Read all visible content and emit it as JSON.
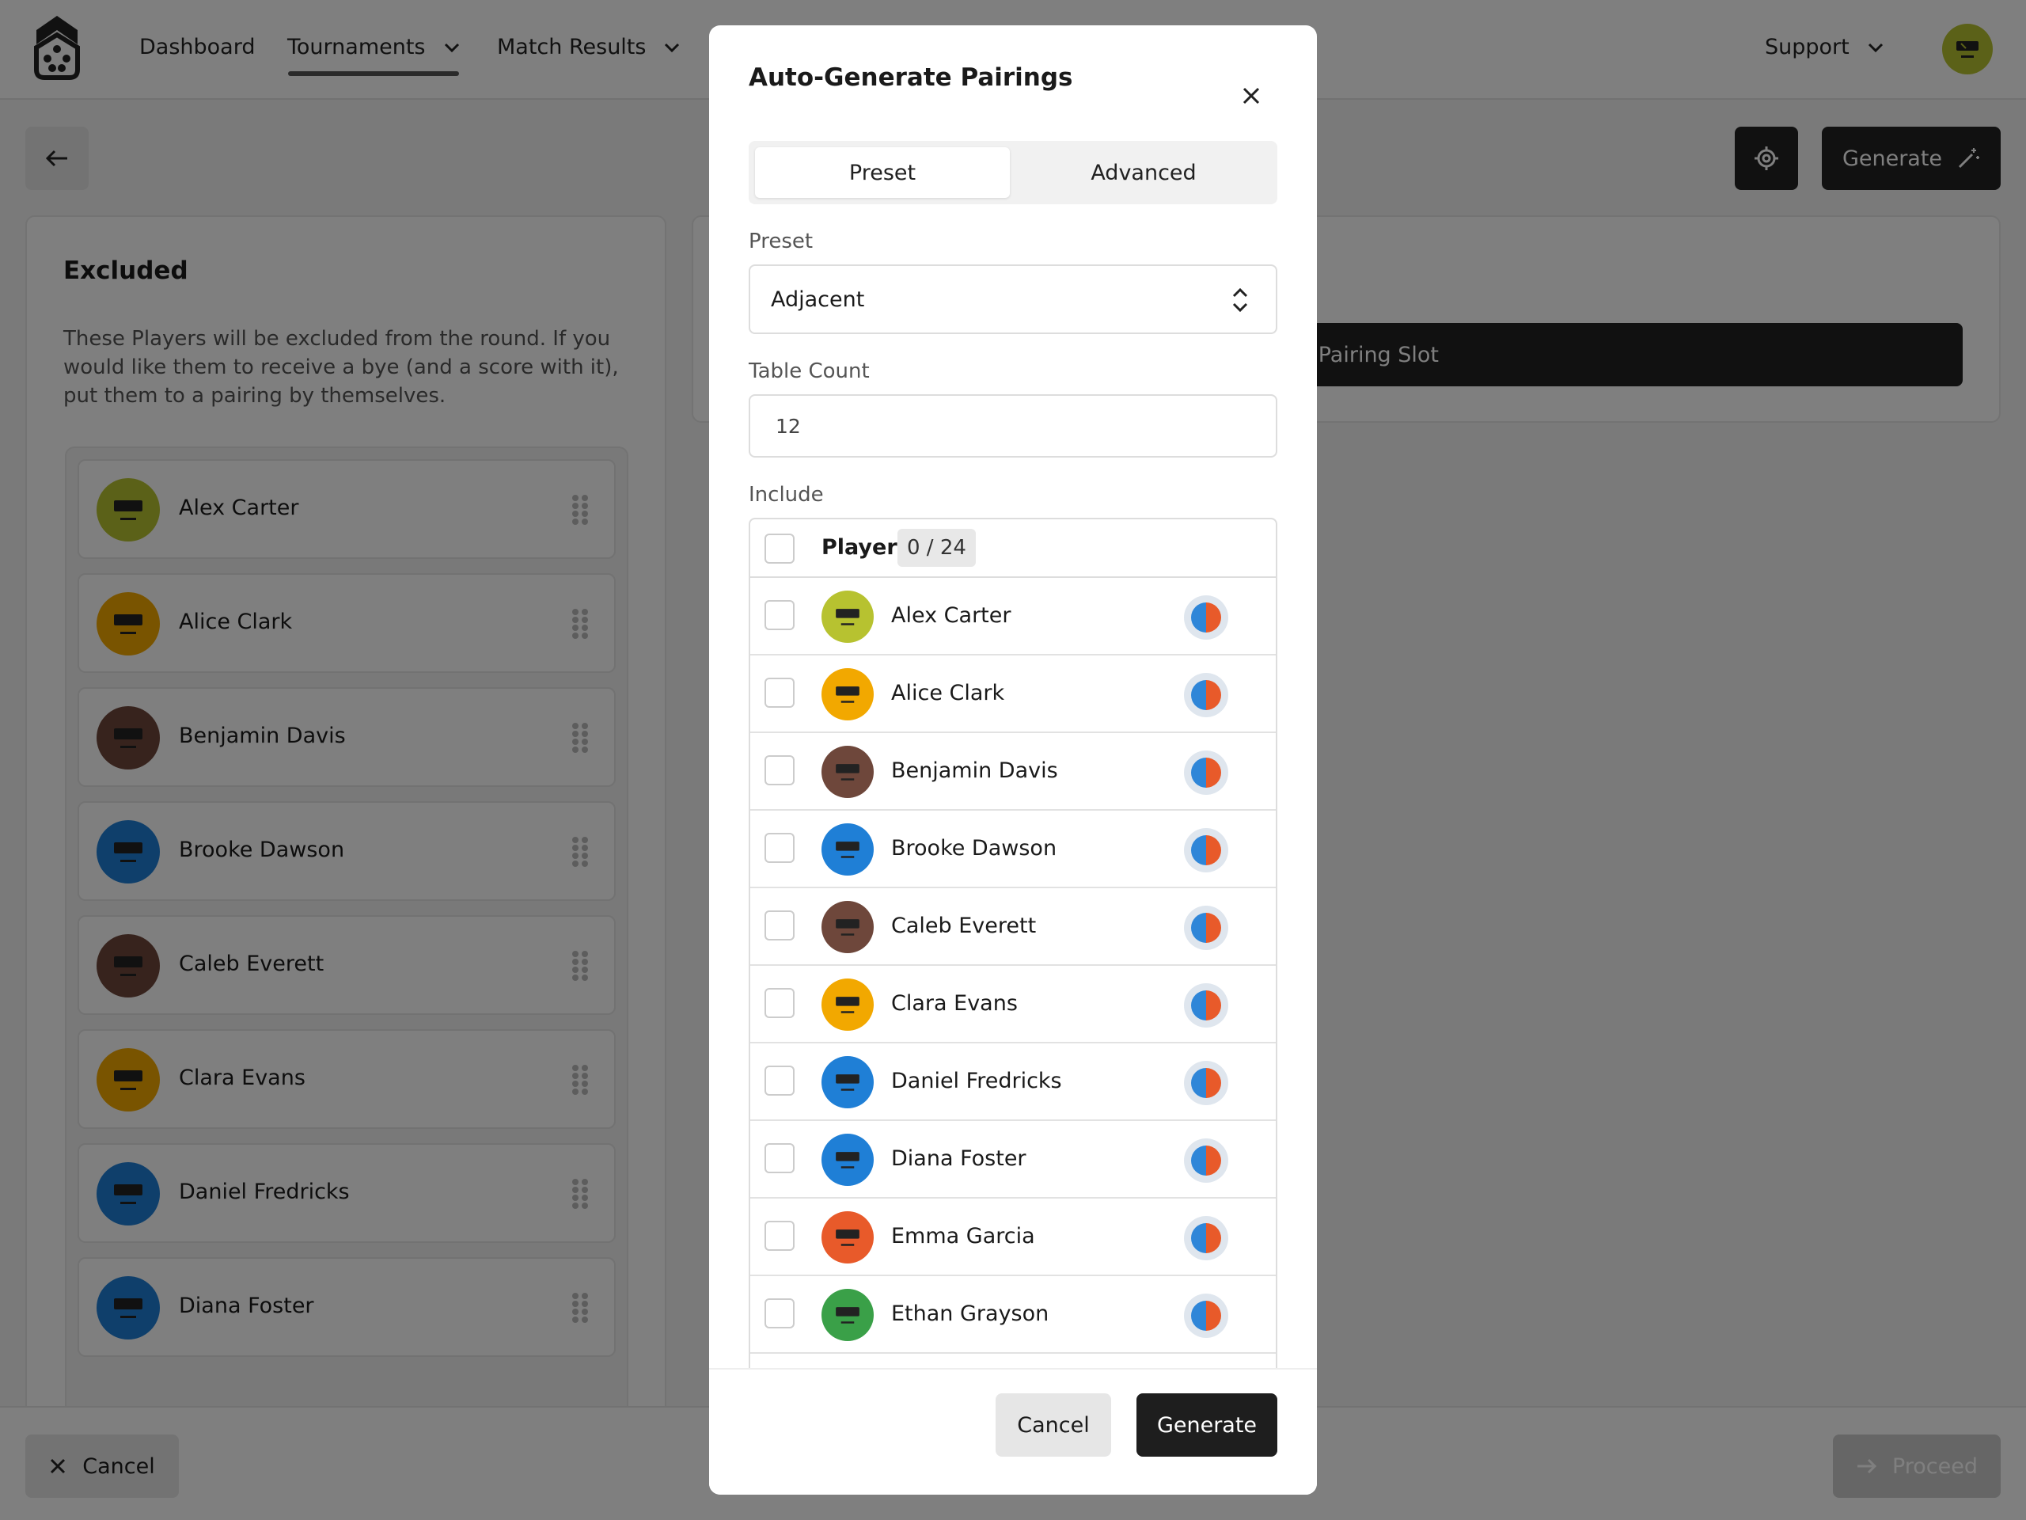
{
  "nav": {
    "items": [
      "Dashboard",
      "Tournaments",
      "Match Results"
    ],
    "support": "Support"
  },
  "toolbar": {
    "generate_label": "Generate"
  },
  "excluded": {
    "title": "Excluded",
    "description": "These Players will be excluded from the round. If you would like them to receive a bye (and a score with it), put them to a pairing by themselves.",
    "players": [
      {
        "name": "Alex Carter",
        "color": "#b7c230"
      },
      {
        "name": "Alice Clark",
        "color": "#f2a800"
      },
      {
        "name": "Benjamin Davis",
        "color": "#6e473b"
      },
      {
        "name": "Brooke Dawson",
        "color": "#1f7fd6"
      },
      {
        "name": "Caleb Everett",
        "color": "#6e473b"
      },
      {
        "name": "Clara Evans",
        "color": "#f2a800"
      },
      {
        "name": "Daniel Fredricks",
        "color": "#1f7fd6"
      },
      {
        "name": "Diana Foster",
        "color": "#1f7fd6"
      }
    ]
  },
  "right": {
    "slot_label": "d Pairing Slot"
  },
  "bottom": {
    "cancel_label": "Cancel",
    "proceed_label": "Proceed"
  },
  "modal": {
    "title": "Auto-Generate Pairings",
    "tabs": [
      "Preset",
      "Advanced"
    ],
    "preset_label": "Preset",
    "preset_value": "Adjacent",
    "table_count_label": "Table Count",
    "table_count_value": "12",
    "include_label": "Include",
    "table_header": "Player",
    "count": "0 / 24",
    "players": [
      {
        "name": "Alex Carter",
        "color": "#b7c230"
      },
      {
        "name": "Alice Clark",
        "color": "#f2a800"
      },
      {
        "name": "Benjamin Davis",
        "color": "#6e473b"
      },
      {
        "name": "Brooke Dawson",
        "color": "#1f7fd6"
      },
      {
        "name": "Caleb Everett",
        "color": "#6e473b"
      },
      {
        "name": "Clara Evans",
        "color": "#f2a800"
      },
      {
        "name": "Daniel Fredricks",
        "color": "#1f7fd6"
      },
      {
        "name": "Diana Foster",
        "color": "#1f7fd6"
      },
      {
        "name": "Emma Garcia",
        "color": "#e85a2a"
      },
      {
        "name": "Ethan Grayson",
        "color": "#3aa048"
      }
    ],
    "cancel_label": "Cancel",
    "generate_label": "Generate"
  }
}
